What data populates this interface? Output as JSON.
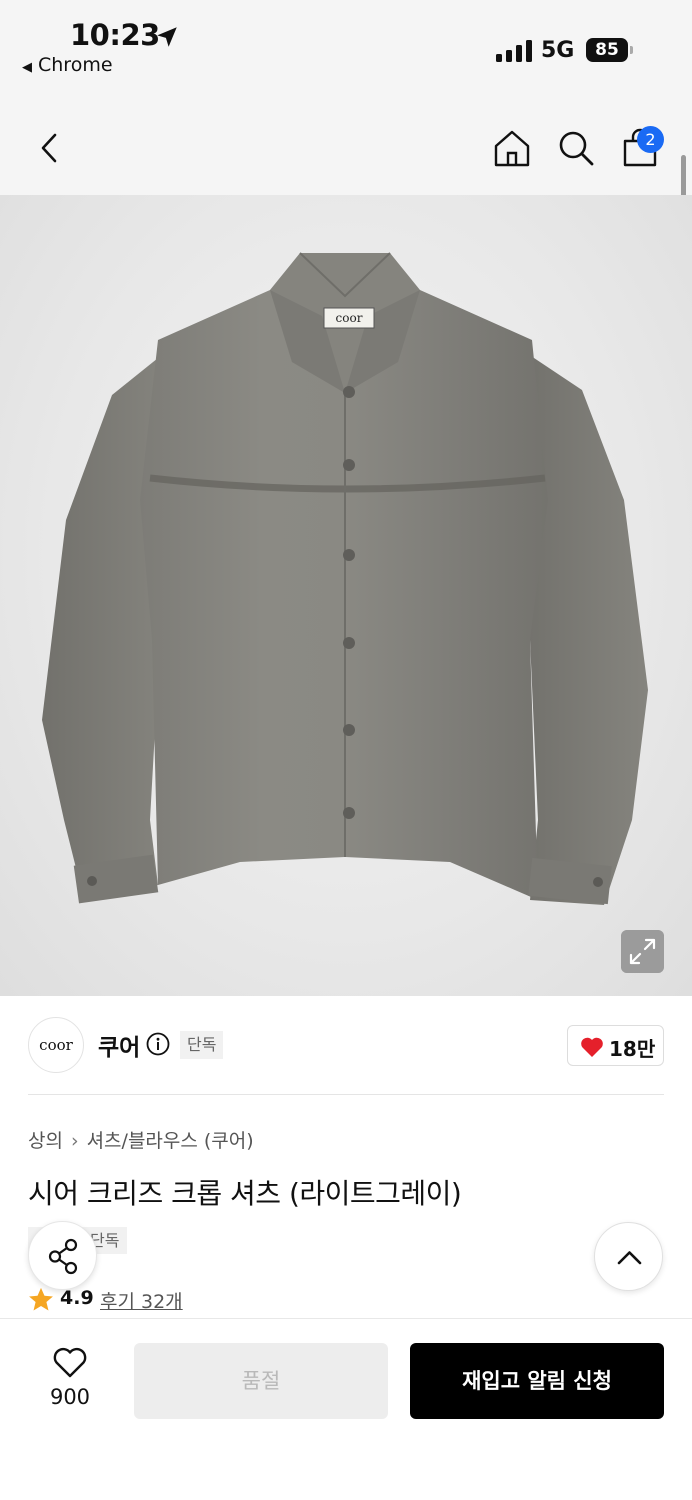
{
  "status_bar": {
    "time": "10:23",
    "back_app": "Chrome",
    "network": "5G",
    "battery": "85"
  },
  "nav": {
    "cart_count": "2",
    "icons": [
      "chevron-left-icon",
      "home-icon",
      "search-icon",
      "shopping-bag-icon"
    ]
  },
  "product_image": {
    "logo_text": "coor"
  },
  "brand": {
    "logo_text": "coor",
    "name": "쿠어",
    "exclusive_tag": "단독",
    "likes": "18만"
  },
  "product": {
    "breadcrumb": [
      "상의",
      "셔츠/블라우스 (쿠어)"
    ],
    "title": "시어 크리즈 크롭 셔츠 (라이트그레이)",
    "tag": "단독",
    "rating": "4.9",
    "reviews": "후기 32개"
  },
  "bottom": {
    "wish_count": "900",
    "soldout_label": "품절",
    "restock_label": "재입고 알림 신청"
  },
  "colors": {
    "accent_blue": "#1a6af4",
    "heart_red": "#e5202b",
    "star_orange": "#f5a623"
  }
}
